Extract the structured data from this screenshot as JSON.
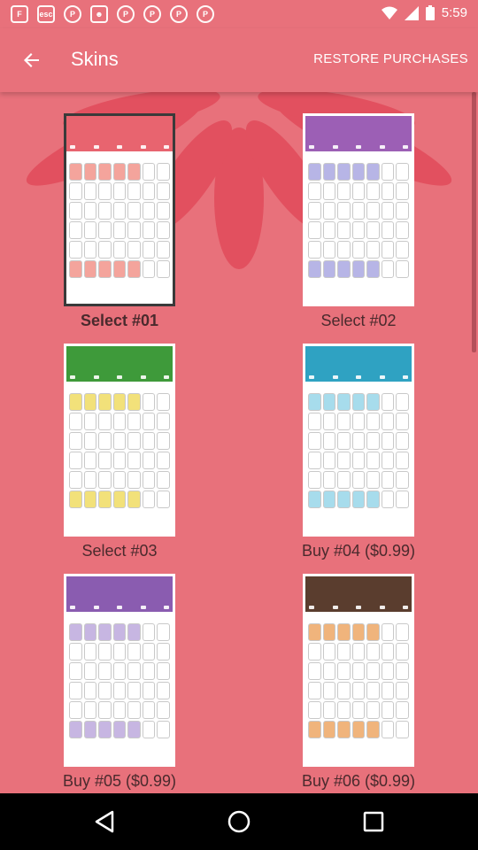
{
  "status_bar": {
    "time": "5:59",
    "left_icons": [
      "flipboard-icon",
      "esc-icon",
      "pinterest-icon",
      "cat-icon",
      "pinterest-icon",
      "pinterest-icon",
      "pinterest-icon",
      "pinterest-icon"
    ]
  },
  "app_bar": {
    "title": "Skins",
    "restore_label": "RESTORE PURCHASES"
  },
  "skins": [
    {
      "label": "Select #01",
      "selected": true,
      "header_color": "#e8646f",
      "cell_accent": "#f4a49c"
    },
    {
      "label": "Select #02",
      "selected": false,
      "header_color": "#9c5fb5",
      "cell_accent": "#b7b5e6"
    },
    {
      "label": "Select #03",
      "selected": false,
      "header_color": "#3e9a3a",
      "cell_accent": "#f2e17a"
    },
    {
      "label": "Buy #04 ($0.99)",
      "selected": false,
      "header_color": "#2fa2c2",
      "cell_accent": "#a7dcec"
    },
    {
      "label": "Buy #05 ($0.99)",
      "selected": false,
      "header_color": "#8a5cb0",
      "cell_accent": "#c7b6e2"
    },
    {
      "label": "Buy #06 ($0.99)",
      "selected": false,
      "header_color": "#5a3d2e",
      "cell_accent": "#f0b47c"
    }
  ],
  "colors": {
    "background": "#e8717b",
    "flower": "#e2505f"
  }
}
